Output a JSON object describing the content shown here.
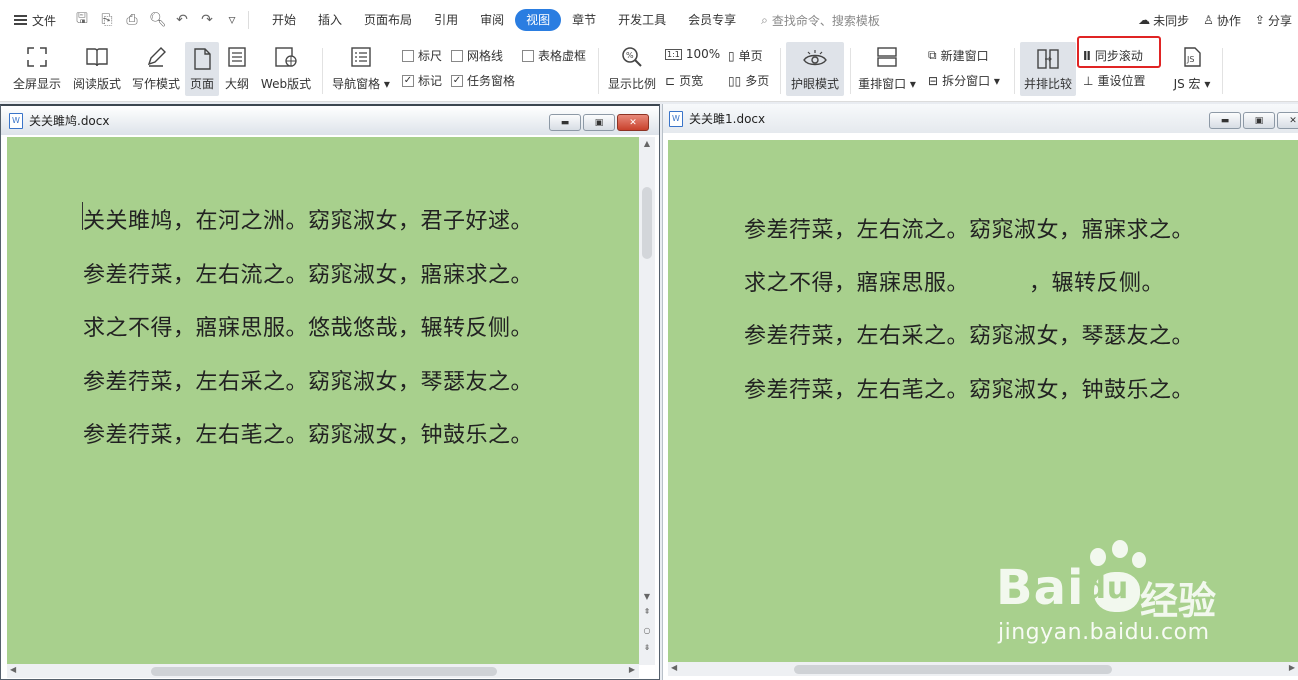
{
  "menu": {
    "file_label": "文件",
    "tabs": [
      {
        "label": "开始",
        "active": false
      },
      {
        "label": "插入",
        "active": false
      },
      {
        "label": "页面布局",
        "active": false
      },
      {
        "label": "引用",
        "active": false
      },
      {
        "label": "审阅",
        "active": false
      },
      {
        "label": "视图",
        "active": true
      },
      {
        "label": "章节",
        "active": false
      },
      {
        "label": "开发工具",
        "active": false
      },
      {
        "label": "会员专享",
        "active": false
      }
    ],
    "search_placeholder": "查找命令、搜索模板",
    "sync_status": "未同步",
    "collab": "协作",
    "share": "分享"
  },
  "ribbon": {
    "fullscreen": "全屏显示",
    "reading": "阅读版式",
    "writing": "写作模式",
    "page": "页面",
    "outline": "大纲",
    "web": "Web版式",
    "nav_pane": "导航窗格",
    "ruler": "标尺",
    "gridlines": "网格线",
    "table_gridlines": "表格虚框",
    "marks": "标记",
    "task_pane": "任务窗格",
    "zoom": "显示比例",
    "zoom_100": "100%",
    "single_page": "单页",
    "page_width": "页宽",
    "multi_page": "多页",
    "eye_protect": "护眼模式",
    "arrange": "重排窗口",
    "new_window": "新建窗口",
    "split_window": "拆分窗口",
    "side_by_side": "并排比较",
    "sync_scroll": "同步滚动",
    "reset_position": "重设位置",
    "js_macro": "JS 宏",
    "checks": {
      "ruler": false,
      "gridlines": false,
      "table_gridlines": false,
      "marks": true,
      "task_pane": true
    }
  },
  "left_window": {
    "title": "关关雎鸠.docx",
    "lines": [
      "关关雎鸠，在河之洲。窈窕淑女，君子好逑。",
      "参差荇菜，左右流之。窈窕淑女，寤寐求之。",
      "求之不得，寤寐思服。悠哉悠哉，辗转反侧。",
      "参差荇菜，左右采之。窈窕淑女，琴瑟友之。",
      "参差荇菜，左右芼之。窈窕淑女，钟鼓乐之。"
    ]
  },
  "right_window": {
    "title": "关关雎1.docx",
    "lines": [
      "参差荇菜，左右流之。窈窕淑女，寤寐求之。",
      "求之不得，寤寐思服。        ，辗转反侧。",
      "参差荇菜，左右采之。窈窕淑女，琴瑟友之。",
      "参差荇菜，左右芼之。窈窕淑女，钟鼓乐之。"
    ]
  },
  "watermark": {
    "brand": "Bai",
    "brand2": "du",
    "cn": "经验",
    "url": "jingyan.baidu.com"
  },
  "colors": {
    "accent": "#2a7de1",
    "page_green": "#a8d08d",
    "highlight_red": "#e02424"
  }
}
